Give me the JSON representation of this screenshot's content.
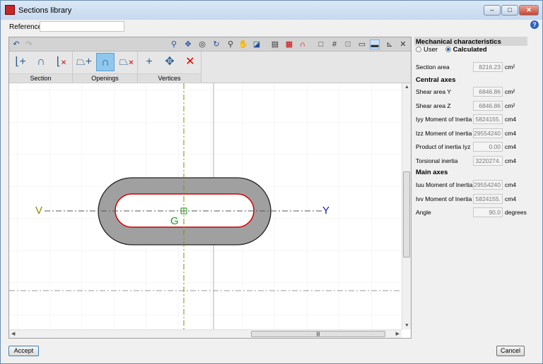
{
  "window": {
    "title": "Sections library",
    "icon": "app-logo-icon",
    "controls": [
      "minimize",
      "maximize",
      "close"
    ]
  },
  "reference": {
    "label": "Reference",
    "value": ""
  },
  "toolbar": {
    "icons": [
      "undo-icon",
      "redo-icon",
      "zoom-window-icon",
      "zoom-all-icon",
      "zoom-x2-icon",
      "redraw-icon",
      "zoom-out-icon",
      "pan-hand-icon",
      "view-icon",
      "import-dxf-icon",
      "import-dwg-icon",
      "snap-magnet-icon",
      "square-icon",
      "grid-icon",
      "grid-point-icon",
      "dimension-icon",
      "ruler-icon",
      "angle-icon",
      "axes-icon"
    ]
  },
  "ribbon": {
    "groups": [
      {
        "label": "Section"
      },
      {
        "label": "Openings"
      },
      {
        "label": "Vertices"
      }
    ]
  },
  "drawing": {
    "axis_v_label": "V",
    "axis_y_label": "Y",
    "centroid_label": "G",
    "colors": {
      "section_fill": "#a0a0a0",
      "outline": "#cc0000",
      "centroid": "#1a9a1a",
      "axis_v": "#8a8a00",
      "axis_y": "#1a1aa0"
    }
  },
  "panel": {
    "title": "Mechanical characteristics",
    "radio_user": "User",
    "radio_calculated": "Calculated",
    "selected": "Calculated",
    "section_area": {
      "label": "Section area",
      "value": "8216.23",
      "unit": "cm²"
    },
    "central_axes": "Central axes",
    "central": [
      {
        "label": "Shear area Y",
        "value": "6846.86",
        "unit": "cm²"
      },
      {
        "label": "Shear area Z",
        "value": "6846.86",
        "unit": "cm²"
      },
      {
        "label": "Iyy Moment of Inertia",
        "value": "5824155.",
        "unit": "cm4"
      },
      {
        "label": "Izz Moment of Inertia",
        "value": "29554240",
        "unit": "cm4"
      },
      {
        "label": "Product of inertia Iyz",
        "value": "0.00",
        "unit": "cm4"
      },
      {
        "label": "Torsional inertia",
        "value": "3220274.",
        "unit": "cm4"
      }
    ],
    "main_axes": "Main axes",
    "main": [
      {
        "label": "Iuu Moment of Inertia",
        "value": "29554240",
        "unit": "cm4"
      },
      {
        "label": "Ivv Moment of Inertia",
        "value": "5824155.",
        "unit": "cm4"
      },
      {
        "label": "Angle",
        "value": "90.0",
        "unit": "degrees"
      }
    ]
  },
  "buttons": {
    "accept": "Accept",
    "cancel": "Cancel"
  }
}
